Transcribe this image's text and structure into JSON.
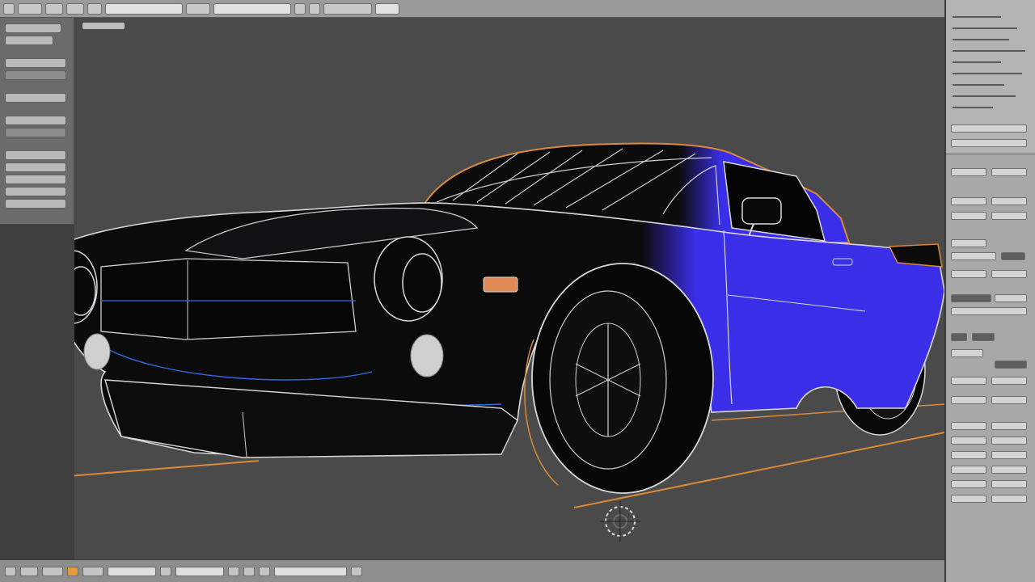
{
  "app": {
    "window_title": ""
  },
  "toolbar": {
    "buttons": [
      "",
      "",
      "",
      "",
      "",
      "",
      "",
      ""
    ],
    "search_placeholder": ""
  },
  "tool_shelf": {
    "rows": 14
  },
  "viewport": {
    "view_label": "",
    "background": "#4a4a4a",
    "model": {
      "colors": {
        "body_black": "#0b0b0c",
        "body_blue": "#3b2ee8",
        "wire_white": "#d8d8d8",
        "wire_orange": "#d88a3a",
        "wire_blue": "#2e6be0"
      }
    },
    "object_origin_icon": "3d-cursor-icon"
  },
  "properties_panel": {
    "rows": 30
  },
  "timeline": {
    "buttons": 12
  },
  "accent": {
    "orange": "#e39a3c",
    "selection_orange": "#d88a3a"
  }
}
